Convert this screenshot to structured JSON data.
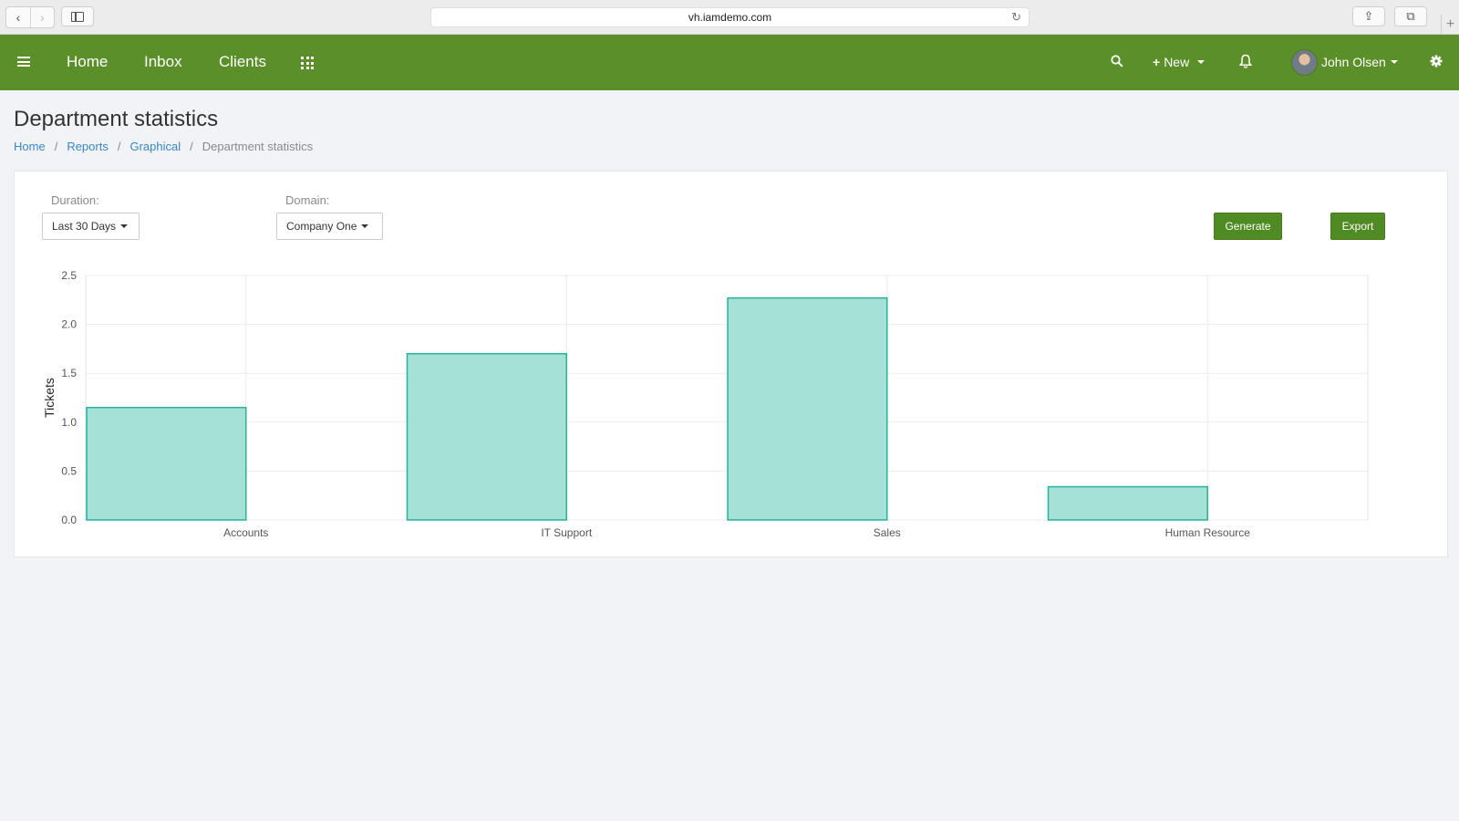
{
  "browser": {
    "url": "vh.iamdemo.com"
  },
  "navbar": {
    "links": [
      "Home",
      "Inbox",
      "Clients"
    ],
    "new_label": "New",
    "user_name": "John Olsen",
    "color": "#5a8f29"
  },
  "page": {
    "title": "Department statistics",
    "breadcrumb": [
      "Home",
      "Reports",
      "Graphical",
      "Department statistics"
    ]
  },
  "filters": {
    "duration_label": "Duration:",
    "duration_value": "Last 30 Days",
    "domain_label": "Domain:",
    "domain_value": "Company One",
    "generate_label": "Generate",
    "export_label": "Export"
  },
  "chart_data": {
    "type": "bar",
    "categories": [
      "Accounts",
      "IT Support",
      "Sales",
      "Human Resource"
    ],
    "values": [
      1.15,
      1.7,
      2.27,
      0.34
    ],
    "ylabel": "Tickets",
    "ylim": [
      0,
      2.5
    ],
    "yticks": [
      "0.0",
      "0.5",
      "1.0",
      "1.5",
      "2.0",
      "2.5"
    ],
    "grid": true,
    "bar_fill": "#a6e1d6",
    "bar_stroke": "#24b39b"
  }
}
